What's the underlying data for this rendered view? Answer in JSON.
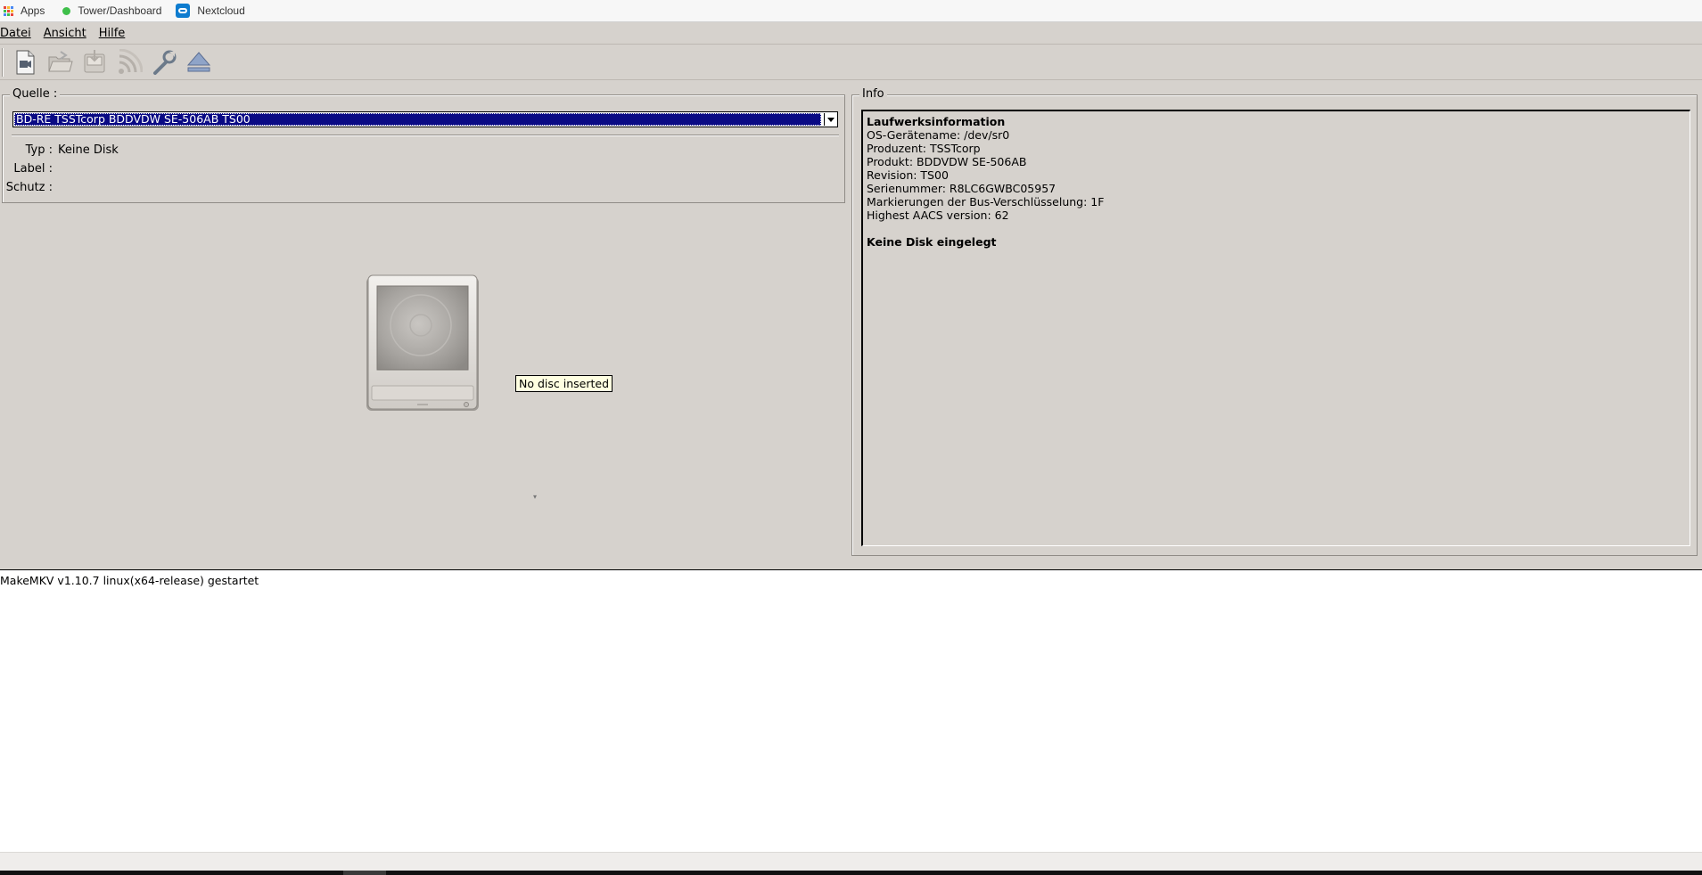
{
  "bookmarks": {
    "apps_label": "Apps",
    "apps_dot_colors": [
      "#e8453c",
      "#f9bb2d",
      "#4a89f3",
      "#3fbf4a",
      "#e8453c",
      "#f9bb2d",
      "#4a89f3",
      "#3fbf4a",
      "#e8453c"
    ],
    "items": [
      {
        "label": "Tower/Dashboard",
        "icon": "green-dot-icon"
      },
      {
        "label": "Nextcloud",
        "icon": "nextcloud-icon"
      }
    ]
  },
  "menubar": {
    "items": [
      {
        "label": "Datei"
      },
      {
        "label": "Ansicht"
      },
      {
        "label": "Hilfe"
      }
    ]
  },
  "toolbar": {
    "buttons": [
      {
        "icon": "open-video-file-icon"
      },
      {
        "icon": "open-folder-icon"
      },
      {
        "icon": "backup-icon"
      },
      {
        "icon": "stream-icon"
      },
      {
        "icon": "settings-wrench-icon"
      },
      {
        "icon": "eject-icon"
      }
    ]
  },
  "source": {
    "title": "Quelle :",
    "selected_drive": "BD-RE TSSTcorp BDDVDW SE-506AB TS00",
    "fields": [
      {
        "label": "Typ :",
        "value": "Keine Disk"
      },
      {
        "label": "Label :",
        "value": ""
      },
      {
        "label": "Schutz :",
        "value": ""
      }
    ],
    "tooltip": "No disc inserted"
  },
  "info": {
    "title": "Info",
    "heading": "Laufwerksinformation",
    "lines": [
      "OS-Gerätename: /dev/sr0",
      "Produzent: TSSTcorp",
      "Produkt: BDDVDW SE-506AB",
      "Revision: TS00",
      "Serienummer: R8LC6GWBC05957",
      "Markierungen der Bus-Verschlüsselung: 1F",
      "Highest AACS version: 62"
    ],
    "status": "Keine Disk eingelegt"
  },
  "log": {
    "lines": [
      "MakeMKV v1.10.7 linux(x64-release) gestartet"
    ]
  },
  "colors": {
    "window_bg": "#d6d2cd",
    "selection_bg": "#0a0a84",
    "tooltip_bg": "#ffffe1"
  }
}
